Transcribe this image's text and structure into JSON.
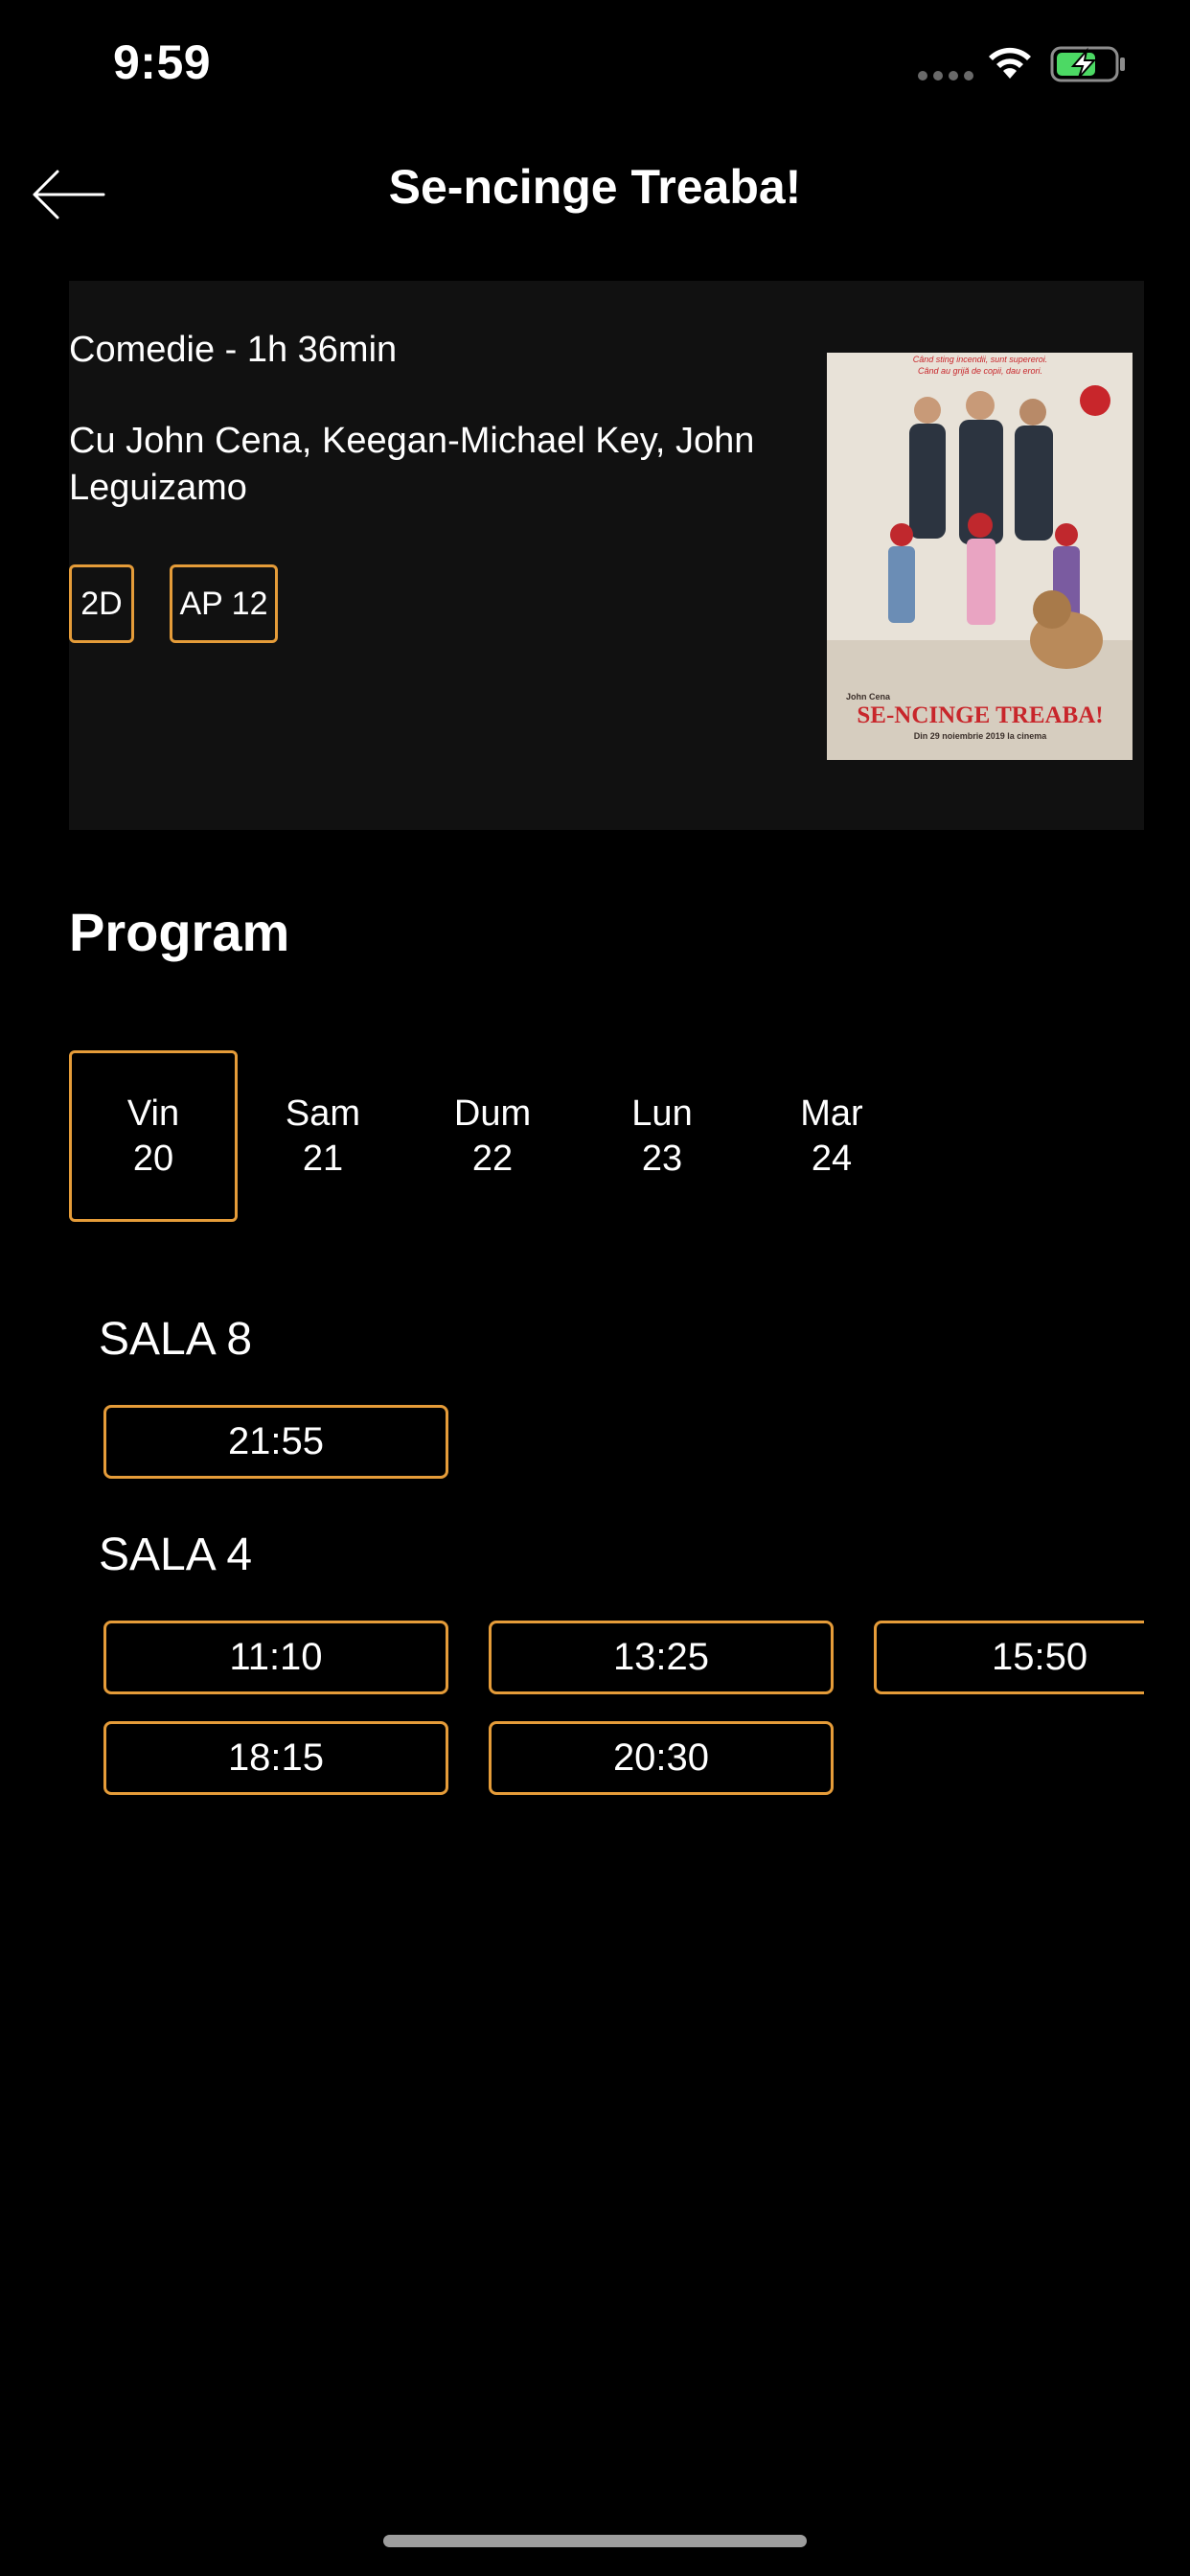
{
  "status_bar": {
    "time": "9:59"
  },
  "header": {
    "title": "Se-ncinge Treaba!"
  },
  "movie": {
    "genre_duration": "Comedie - 1h 36min",
    "cast": "Cu John Cena, Keegan-Michael Key, John Leguizamo",
    "tags": [
      "2D",
      "AP 12"
    ],
    "poster": {
      "tagline_1": "Când sting incendii, sunt supereroi.",
      "tagline_2": "Când au grijă de copii, dau erori.",
      "actor": "John Cena",
      "title": "SE-NCINGE TREABA!",
      "release": "Din 29 noiembrie 2019 la cinema"
    }
  },
  "program": {
    "title": "Program",
    "dates": [
      {
        "day": "Vin",
        "num": "20",
        "selected": true
      },
      {
        "day": "Sam",
        "num": "21",
        "selected": false
      },
      {
        "day": "Dum",
        "num": "22",
        "selected": false
      },
      {
        "day": "Lun",
        "num": "23",
        "selected": false
      },
      {
        "day": "Mar",
        "num": "24",
        "selected": false
      }
    ],
    "halls": [
      {
        "name": "SALA 8",
        "times": [
          "21:55"
        ]
      },
      {
        "name": "SALA 4",
        "times": [
          "11:10",
          "13:25",
          "15:50",
          "18:15",
          "20:30"
        ]
      }
    ]
  },
  "colors": {
    "accent": "#e59c39",
    "background": "#000000",
    "card": "#111111"
  }
}
